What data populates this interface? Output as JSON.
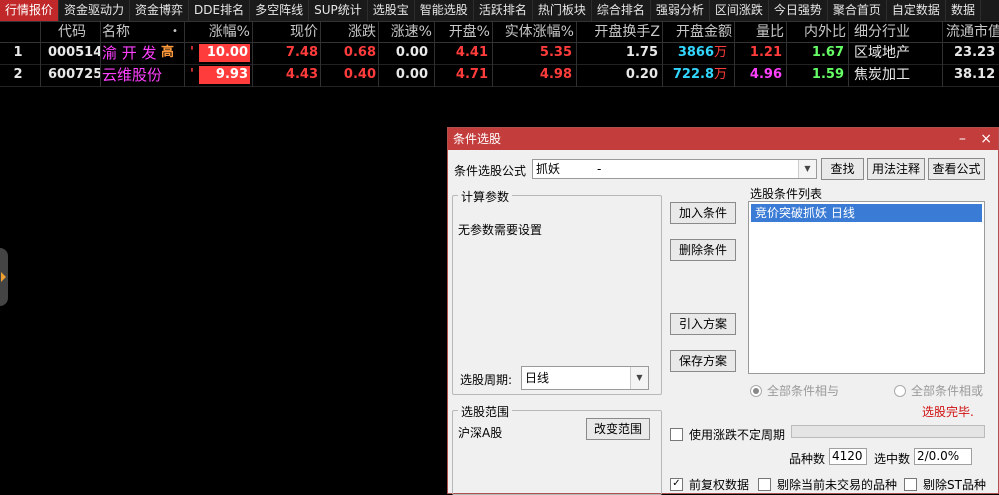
{
  "tabs": [
    "行情报价",
    "资金驱动力",
    "资金博弈",
    "DDE排名",
    "多空阵线",
    "SUP统计",
    "选股宝",
    "智能选股",
    "活跃排名",
    "热门板块",
    "综合排名",
    "强弱分析",
    "区间涨跌",
    "今日强势",
    "聚合首页",
    "自定数据",
    "数据"
  ],
  "table": {
    "headers": {
      "idx": "",
      "code": "代码",
      "name": "名称",
      "dot": "•",
      "chg_pct": "涨幅%",
      "price": "现价",
      "change": "涨跌",
      "speed": "涨速%",
      "open_pct": "开盘%",
      "body_pct": "实体涨幅%",
      "open_turn": "开盘换手Z",
      "open_amt": "开盘金额",
      "vol_ratio": "量比",
      "io_ratio": "内外比",
      "industry": "细分行业",
      "float_cap": "流通市值"
    },
    "rows": [
      {
        "idx": "1",
        "code": "000514",
        "name": "渝 开 发",
        "tag": "高",
        "mark": "'",
        "chg_pct": "10.00",
        "price": "7.48",
        "change": "0.68",
        "speed": "0.00",
        "open_pct": "4.41",
        "body_pct": "5.35",
        "open_turn": "1.75",
        "open_amt": "3866",
        "open_amt_unit": "万",
        "vol_ratio": "1.21",
        "io_ratio": "1.67",
        "industry": "区域地产",
        "float_cap": "23.23"
      },
      {
        "idx": "2",
        "code": "600725",
        "name": "云维股份",
        "tag": "",
        "mark": "'",
        "chg_pct": "9.93",
        "price": "4.43",
        "change": "0.40",
        "speed": "0.00",
        "open_pct": "4.71",
        "body_pct": "4.98",
        "open_turn": "0.20",
        "open_amt": "722.8",
        "open_amt_unit": "万",
        "vol_ratio": "4.96",
        "io_ratio": "1.59",
        "industry": "焦炭加工",
        "float_cap": "38.12"
      }
    ]
  },
  "dialog": {
    "title": "条件选股",
    "formula_label": "条件选股公式",
    "formula_value": "抓妖",
    "formula_dash": "-",
    "find_btn": "查找",
    "usage_btn": "用法注释",
    "view_btn": "查看公式",
    "params_group": "计算参数",
    "params_text": "无参数需要设置",
    "period_label": "选股周期:",
    "period_value": "日线",
    "add_btn": "加入条件",
    "del_btn": "删除条件",
    "import_btn": "引入方案",
    "save_btn": "保存方案",
    "cond_list_label": "选股条件列表",
    "cond_items": [
      "竞价突破抓妖  日线"
    ],
    "radio_and": "全部条件相与",
    "radio_or": "全部条件相或",
    "status": "选股完毕.",
    "range_group": "选股范围",
    "range_value": "沪深A股",
    "change_range_btn": "改变范围",
    "use_uncertain": "使用涨跌不定周期",
    "count_label": "品种数",
    "count_value": "4120",
    "selected_label": "选中数",
    "selected_value": "2/0.0%",
    "prev_adjust": "前复权数据",
    "exclude_untraded": "剔除当前未交易的品种",
    "exclude_st": "剔除ST品种"
  }
}
